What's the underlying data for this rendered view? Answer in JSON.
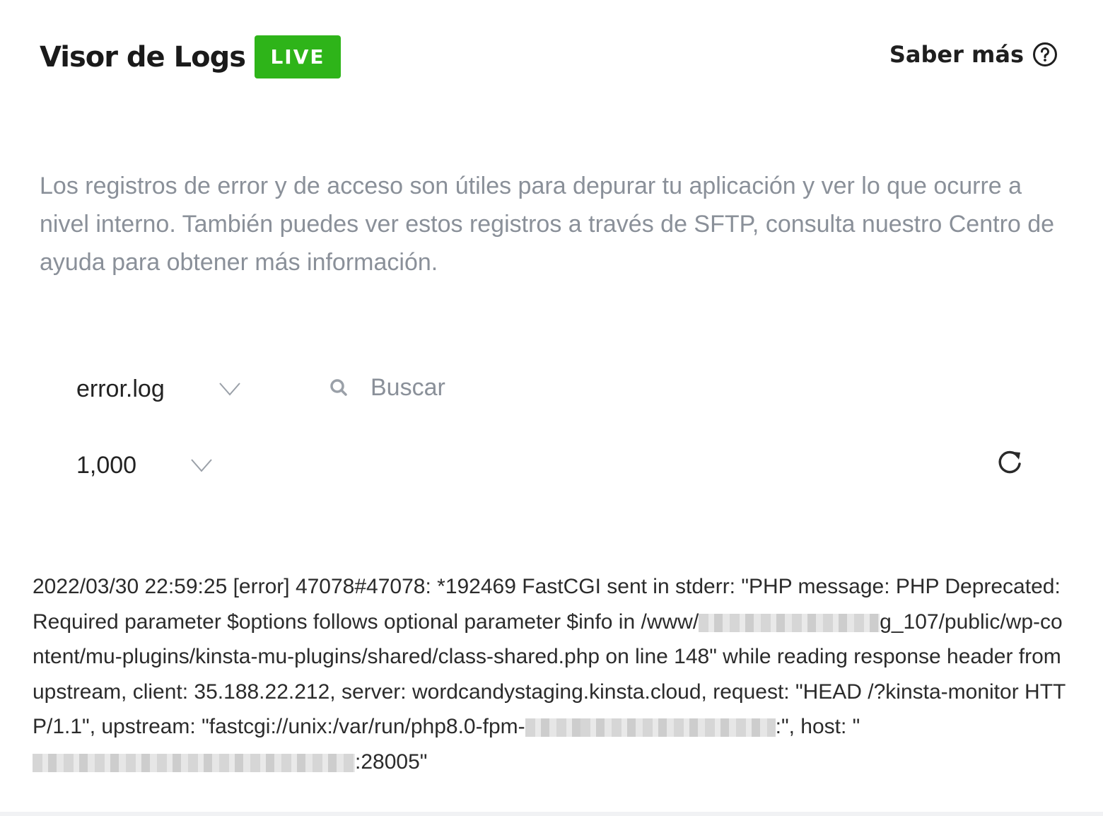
{
  "header": {
    "title": "Visor de Logs",
    "badge": "LIVE",
    "learn_more": "Saber más",
    "help_icon": "question-circle-icon"
  },
  "description": "Los registros de error y de acceso son útiles para depurar tu aplicación y ver lo que ocurre a nivel interno. También puedes ver estos registros a través de SFTP, consulta nuestro Centro de ayuda para obtener más información.",
  "filters": {
    "log_file": "error.log",
    "search_placeholder": "Buscar",
    "search_value": "",
    "lines": "1,000",
    "refresh_icon": "refresh-icon"
  },
  "log": {
    "part1": "2022/03/30 22:59:25 [error] 47078#47078: *192469 FastCGI sent in stderr: \"PHP message: PHP Deprecated: Required parameter $options follows optional parameter $info in /www/",
    "part2": "g_107/public/wp-content/mu-plugins/kinsta-mu-plugins/shared/class-shared.php on line 148\" while reading response header from upstream, client: 35.188.22.212, server: wordcandystaging.kinsta.cloud, request: \"HEAD /?kinsta-monitor HTTP/1.1\", upstream: \"fastcgi://unix:/var/run/php8.0-fpm-",
    "part3": ":\", host: \"",
    "part4": ":28005\""
  },
  "colors": {
    "live_badge": "#2eb419",
    "muted_text": "#8a9099",
    "body_text": "#2b2b2b"
  }
}
